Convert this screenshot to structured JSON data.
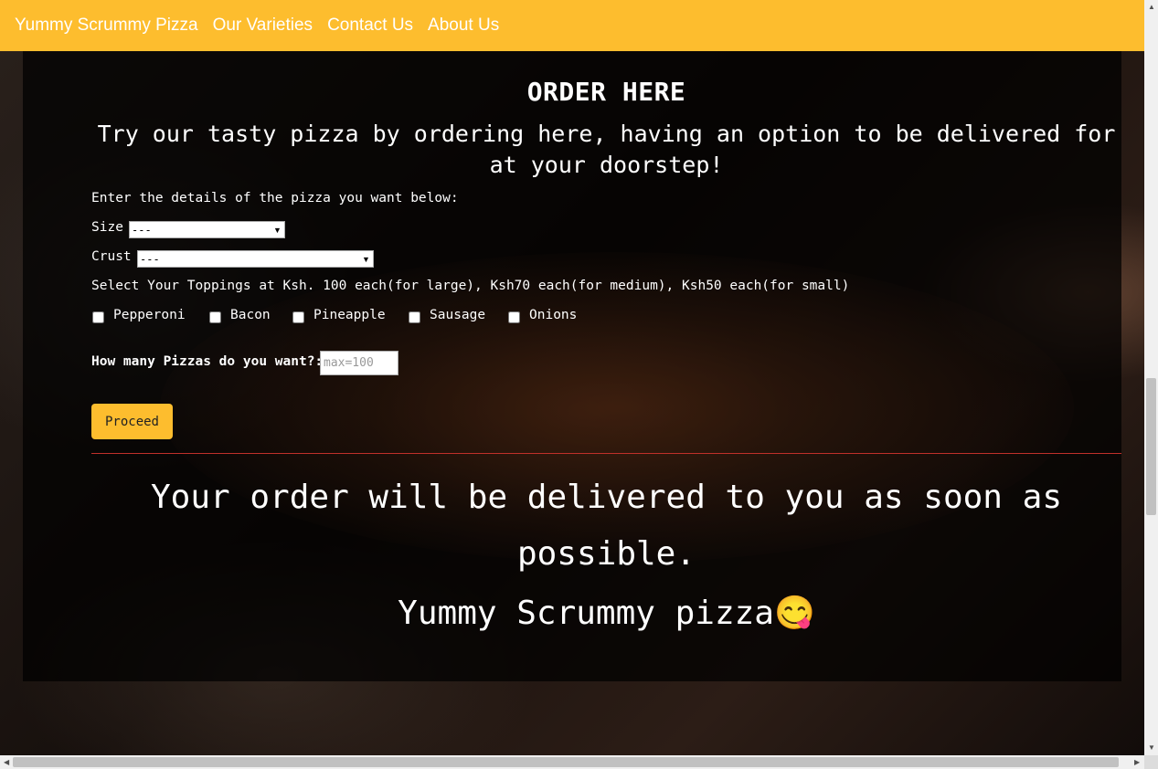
{
  "nav": {
    "brand": "Yummy Scrummy Pizza",
    "links": [
      "Our Varieties",
      "Contact Us",
      "About Us"
    ]
  },
  "order": {
    "title": "ORDER HERE",
    "subtitle": "Try our tasty pizza by ordering here, having an option to be delivered for at your doorstep!",
    "instructions": "Enter the details of the pizza you want below:",
    "size_label": "Size",
    "size_value": "---",
    "crust_label": "Crust",
    "crust_value": "---",
    "toppings_label": "Select Your Toppings at Ksh. 100 each(for large), Ksh70 each(for medium), Ksh50 each(for small)",
    "toppings": [
      "Pepperoni",
      "Bacon",
      "Pineapple",
      "Sausage",
      "Onions"
    ],
    "quantity_label": "How many Pizzas do you want?:",
    "quantity_placeholder": "max=100",
    "proceed_label": "Proceed"
  },
  "footer_message": {
    "delivery": "Your order will be delivered to you as soon as possible.",
    "signature": "Yummy Scrummy pizza😋"
  },
  "colors": {
    "navbar": "#fdbd2e",
    "button": "#fdbd2e",
    "divider": "#c0302a",
    "text": "#ffffff"
  }
}
